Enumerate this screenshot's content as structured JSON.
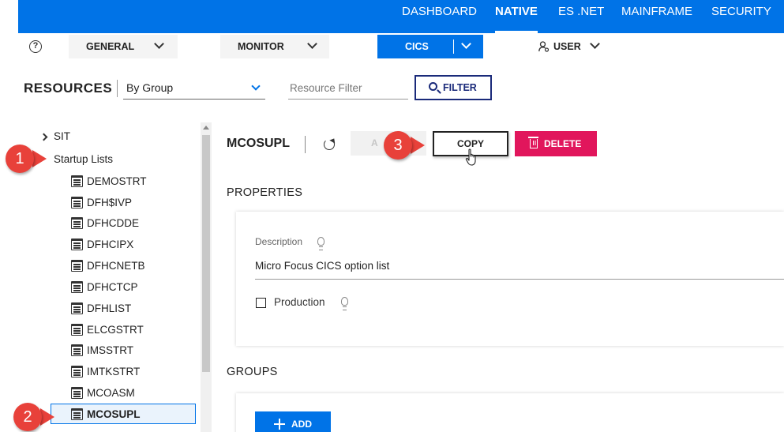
{
  "topnav": {
    "items": [
      {
        "label": "DASHBOARD"
      },
      {
        "label": "NATIVE"
      },
      {
        "label": "ES .NET"
      },
      {
        "label": "MAINFRAME"
      },
      {
        "label": "SECURITY"
      }
    ],
    "active": "NATIVE"
  },
  "subbar": {
    "help_glyph": "?",
    "general": "GENERAL",
    "monitor": "MONITOR",
    "cics": "CICS",
    "user": "USER"
  },
  "resources": {
    "title": "RESOURCES",
    "grouping": "By Group",
    "filter_placeholder": "Resource Filter",
    "filter_button": "FILTER"
  },
  "tree": {
    "sit": "SIT",
    "startup_lists": "Startup Lists",
    "items": [
      {
        "label": "DEMOSTRT"
      },
      {
        "label": "DFH$IVP"
      },
      {
        "label": "DFHCDDE"
      },
      {
        "label": "DFHCIPX"
      },
      {
        "label": "DFHCNETB"
      },
      {
        "label": "DFHCTCP"
      },
      {
        "label": "DFHLIST"
      },
      {
        "label": "ELCGSTRT"
      },
      {
        "label": "IMSSTRT"
      },
      {
        "label": "IMTKSTRT"
      },
      {
        "label": "MCOASM"
      },
      {
        "label": "MCOSUPL"
      }
    ],
    "selected": "MCOSUPL"
  },
  "callouts": [
    "1",
    "2",
    "3"
  ],
  "detail": {
    "title": "MCOSUPL",
    "ghost_button": "A",
    "copy_button": "COPY",
    "delete_button": "DELETE",
    "properties_title": "PROPERTIES",
    "description_label": "Description",
    "description_value": "Micro Focus CICS option list",
    "production_label": "Production",
    "production_checked": false,
    "groups_title": "GROUPS",
    "add_button": "ADD"
  },
  "colors": {
    "brand_blue": "#0073e7",
    "delete_pink": "#e1165c",
    "callout_red": "#e8413a",
    "filter_navy": "#1a2a7a"
  }
}
